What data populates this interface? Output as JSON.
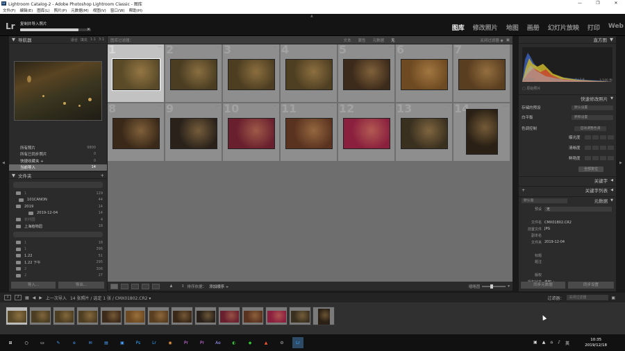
{
  "window": {
    "title": "Lightroom Catalog-2 - Adobe Photoshop Lightroom Classic - 图库",
    "controls": [
      "—",
      "❐",
      "✕"
    ]
  },
  "menu": [
    "文件(F)",
    "编辑(E)",
    "图库(L)",
    "照片(P)",
    "元数据(M)",
    "视图(V)",
    "窗口(W)",
    "帮助(H)"
  ],
  "identity": {
    "logo": "Lr",
    "import_status": "复制并导入照片",
    "import_progress": 0.82
  },
  "modules": [
    {
      "label": "图库",
      "active": true
    },
    {
      "label": "修改照片",
      "active": false
    },
    {
      "label": "地图",
      "active": false
    },
    {
      "label": "画册",
      "active": false
    },
    {
      "label": "幻灯片放映",
      "active": false
    },
    {
      "label": "打印",
      "active": false
    },
    {
      "label": "Web",
      "active": false
    }
  ],
  "left": {
    "navigator_title": "导航器",
    "navigator_views": [
      "适合",
      "填充",
      "1:1",
      "3:1"
    ],
    "catalog": [
      {
        "label": "所有照片",
        "count": "9800"
      },
      {
        "label": "所有已同步照片",
        "count": "0"
      },
      {
        "label": "快捷收藏夹 +",
        "count": "0"
      },
      {
        "label": "当前导入",
        "count": "14",
        "selected": true
      }
    ],
    "folders_title": "文件夹",
    "folders": [
      {
        "label": "1",
        "count": "129",
        "indent": 10,
        "dim": true
      },
      {
        "label": "101CANON",
        "count": "44",
        "indent": 14
      },
      {
        "label": "2019",
        "count": "14",
        "indent": 10
      },
      {
        "label": "2019-12-04",
        "count": "14",
        "indent": 28
      },
      {
        "label": "农村园",
        "count": "4",
        "indent": 10,
        "dim": true
      },
      {
        "label": "上海植物园",
        "count": "18",
        "indent": 10
      },
      {
        "label": "",
        "count": "",
        "indent": 0
      },
      {
        "label": "1",
        "count": "18",
        "indent": 10,
        "dim": true
      },
      {
        "label": "1",
        "count": "396",
        "indent": 10,
        "dim": true
      },
      {
        "label": "1.22",
        "count": "51",
        "indent": 10
      },
      {
        "label": "1.22 下午",
        "count": "295",
        "indent": 10
      },
      {
        "label": "2",
        "count": "306",
        "indent": 10,
        "dim": true
      },
      {
        "label": "2",
        "count": "27",
        "indent": 10,
        "dim": true
      }
    ],
    "import_button": "导入...",
    "export_button": "导出..."
  },
  "filter_bar": {
    "title": "图库过滤器：",
    "options": [
      "文本",
      "属性",
      "元数据",
      "无"
    ],
    "active": "无",
    "preset": "关闭过滤器 ◆"
  },
  "grid": {
    "cells": [
      {
        "n": "1",
        "selected": true,
        "color": "#5a4a28",
        "portrait": false
      },
      {
        "n": "2",
        "color": "#4a3d22",
        "portrait": false
      },
      {
        "n": "3",
        "color": "#4d3e21",
        "portrait": false
      },
      {
        "n": "4",
        "color": "#4f3f22",
        "portrait": false
      },
      {
        "n": "5",
        "color": "#3c2a1a",
        "portrait": false
      },
      {
        "n": "6",
        "color": "#6e4a22",
        "portrait": false
      },
      {
        "n": "7",
        "color": "#5a3e20",
        "portrait": false
      },
      {
        "n": "8",
        "color": "#3a2818",
        "portrait": false
      },
      {
        "n": "9",
        "color": "#2a221a",
        "portrait": false
      },
      {
        "n": "10",
        "color": "#6a1f2e",
        "portrait": false
      },
      {
        "n": "11",
        "color": "#5a3320",
        "portrait": false
      },
      {
        "n": "12",
        "color": "#8a1f3e",
        "portrait": false
      },
      {
        "n": "13",
        "color": "#3a3020",
        "portrait": false
      },
      {
        "n": "14",
        "color": "#2a2015",
        "portrait": true
      }
    ]
  },
  "toolbar": {
    "sort_label": "排序依据：",
    "sort_value": "添加顺序 ÷",
    "thumbnails_label": "缩略图"
  },
  "right": {
    "histogram_title": "直方图",
    "histogram_info": [
      "ISO 800",
      "70 mm",
      "ƒ / 2.8",
      "1/100 秒"
    ],
    "original_label": "原始照片",
    "quick_develop_title": "快速修改照片",
    "quick_develop_rows": [
      {
        "label": "存储的预设",
        "value": "默认设置"
      },
      {
        "label": "白平衡",
        "value": "原照设置"
      }
    ],
    "tone_control_label": "色调控制",
    "tone_auto": "自动调整色调",
    "tone_rows": [
      "曝光度",
      "清晰度",
      "鲜艳度"
    ],
    "reset_all": "全部复位",
    "keywording_title": "关键字",
    "keyword_list_title": "关键字列表",
    "metadata_title": "元数据",
    "metadata_preset": "默认值",
    "metadata": [
      {
        "k": "预设",
        "v": "无"
      },
      {
        "k": "",
        "v": ""
      },
      {
        "k": "文件名",
        "v": "CMX01802.CR2"
      },
      {
        "k": "前置文件",
        "v": "JPG"
      },
      {
        "k": "副本名",
        "v": ""
      },
      {
        "k": "文件夹",
        "v": "2019-12-04"
      },
      {
        "k": "",
        "v": ""
      },
      {
        "k": "标题",
        "v": ""
      },
      {
        "k": "题注",
        "v": ""
      },
      {
        "k": "",
        "v": ""
      },
      {
        "k": "版权",
        "v": ""
      },
      {
        "k": "版权状态",
        "v": "未知 ÷"
      }
    ],
    "sync_metadata": "同步元数据",
    "sync_settings": "同步设置"
  },
  "filmstrip_bar": {
    "screen1": "1",
    "screen2": "2",
    "source": "上一次导入",
    "count": "14 张照片 / 选定 1 张 / CMX01802.CR2 ▾",
    "filter_label": "过滤器：",
    "filter_value": "关闭过滤器"
  },
  "filmstrip": [
    "#5a4a28",
    "#4a3d22",
    "#4d3e21",
    "#4f3f22",
    "#3c2a1a",
    "#6e4a22",
    "#5a3e20",
    "#3a2818",
    "#2a221a",
    "#6a1f2e",
    "#5a3320",
    "#8a1f3e",
    "#3a3020",
    "#2a2015"
  ],
  "taskbar": {
    "icons": [
      "⊞",
      "○",
      "▭",
      "✎",
      "e",
      "✉",
      "▤",
      "▣",
      "Ps",
      "Lr",
      "◉",
      "Pr",
      "Pr",
      "Ae",
      "◐",
      "◆",
      "▲",
      "⚙",
      "Lr"
    ],
    "tray": [
      "▣",
      "▲",
      "⌂",
      "♪",
      "英"
    ],
    "time": "10:35",
    "date": "2019/12/18"
  }
}
